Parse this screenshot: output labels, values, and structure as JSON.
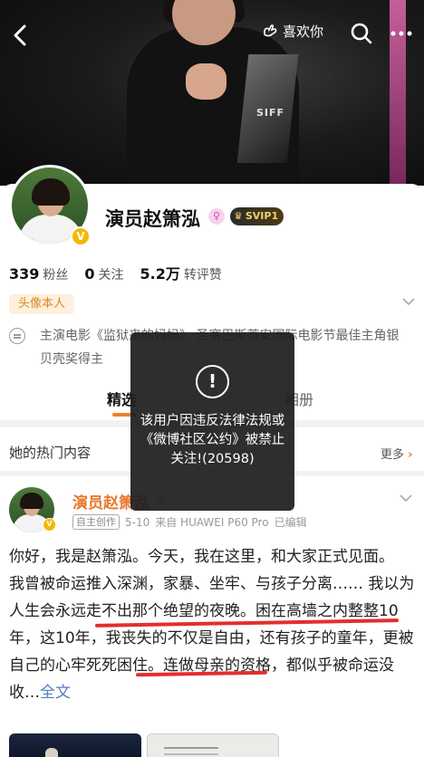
{
  "header": {
    "like_label": "喜欢你"
  },
  "cover": {
    "trophy_text": "SIFF"
  },
  "profile": {
    "username": "演员赵箫泓",
    "svip_label": "SVIP1",
    "stats": [
      {
        "value": "339",
        "label": "粉丝"
      },
      {
        "value": "0",
        "label": "关注"
      },
      {
        "value": "5.2万",
        "label": "转评赞"
      }
    ],
    "tag": "头像本人",
    "bio": "主演电影《监狱来的妈妈》 圣塞巴斯蒂安国际电影节最佳主角银贝壳奖得主",
    "tabs": [
      "精选",
      "相册"
    ]
  },
  "hot": {
    "title": "她的热门内容",
    "more_label": "更多",
    "post": {
      "author": "演员赵箫泓",
      "badge": "自主创作",
      "date": "5-10",
      "source": "来自 HUAWEI P60 Pro",
      "edited": "已编辑",
      "paragraph1": "你好，我是赵箫泓。今天，我在这里，和大家正式见面。",
      "paragraph2": "我曾被命运推入深渊，家暴、坐牢、与孩子分离…… 我以为人生会永远走不出那个绝望的夜晚。困在高墙之内整整10年，这10年，我丧失的不仅是自由，还有孩子的童年，更被自己的心牢死死困住。连做母亲的资格，都似乎被命运没收…",
      "full_label": "全文"
    }
  },
  "toast": {
    "icon": "!",
    "message": "该用户因违反法律法规或《微博社区公约》被禁止关注!(20598)"
  },
  "colors": {
    "accent_orange": "#f57f2c",
    "link_blue": "#4f7ec2",
    "verify_gold": "#f5b800",
    "strike_red": "#e52d2d"
  }
}
